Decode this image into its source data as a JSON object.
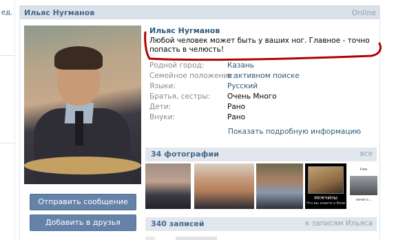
{
  "left_fragment": "ед.",
  "header": {
    "name": "Ильяс Нугманов",
    "status": "Online"
  },
  "profile": {
    "name": "Ильяс Нугманов",
    "status_text": "Любой человек может быть у ваших ног. Главное - точно попасть в челюсть!",
    "fields": [
      {
        "label": "Родной город:",
        "value": "Казань",
        "link": true
      },
      {
        "label": "Семейное положение:",
        "value": "в активном поиске",
        "link": true
      },
      {
        "label": "Языки:",
        "value": "Русский",
        "link": true
      },
      {
        "label": "Братья, сестры:",
        "value": "Очень Много",
        "link": false
      },
      {
        "label": "Дети:",
        "value": "Рано",
        "link": false
      },
      {
        "label": "Внуки:",
        "value": "Рано",
        "link": false
      }
    ],
    "more_info": "Показать подробную информацию"
  },
  "actions": {
    "send_message": "Отправить сообщение",
    "add_friend": "Добавить в друзья"
  },
  "photos": {
    "title": "34 фотографии",
    "all": "все",
    "demotivator_caption": "МУЖЧИНЫ",
    "demotivator_sub": "Что вы знаете о боли",
    "meme_top": "Уже",
    "meme_bottom": "ничего..."
  },
  "wall": {
    "title": "340 записей",
    "link": "к записям Ильяса"
  },
  "colors": {
    "accent": "#45688e",
    "link": "#2b587a",
    "button": "#6583a8",
    "annotation": "#b00000"
  }
}
